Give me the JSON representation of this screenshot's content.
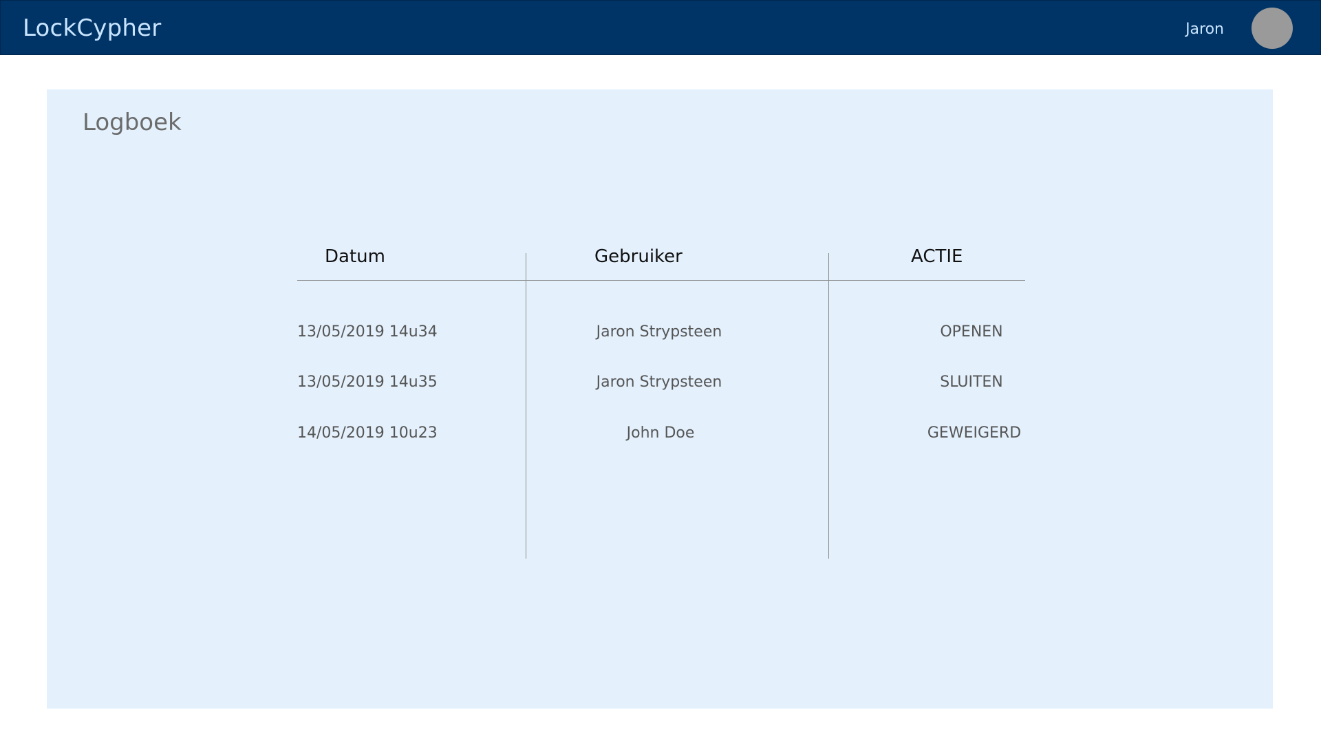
{
  "header": {
    "brand": "LockCypher",
    "username": "Jaron"
  },
  "main": {
    "title": "Logboek",
    "table": {
      "columns": [
        "Datum",
        "Gebruiker",
        "ACTIE"
      ],
      "rows": [
        {
          "datum": "13/05/2019 14u34",
          "gebruiker": "Jaron Strypsteen",
          "actie": "OPENEN"
        },
        {
          "datum": "13/05/2019 14u35",
          "gebruiker": "Jaron Strypsteen",
          "actie": "SLUITEN"
        },
        {
          "datum": "14/05/2019 10u23",
          "gebruiker": "John Doe",
          "actie": "GEWEIGERD"
        }
      ]
    }
  },
  "colors": {
    "topbar": "#003466",
    "brand_text": "#c9e4ff",
    "panel": "#e4f1fd"
  }
}
